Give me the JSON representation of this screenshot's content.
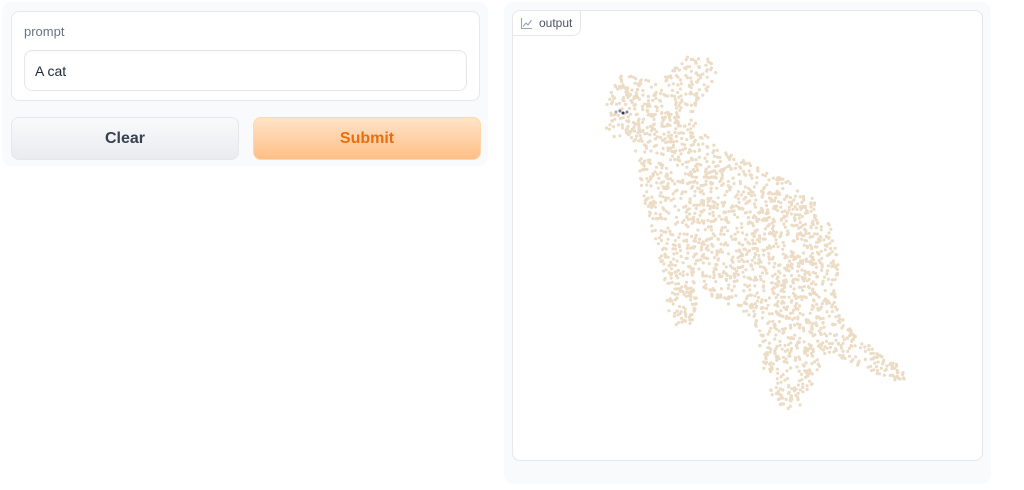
{
  "input": {
    "label": "prompt",
    "value": "A cat"
  },
  "buttons": {
    "clear_label": "Clear",
    "submit_label": "Submit"
  },
  "output": {
    "label": "output",
    "icon": "line-chart-icon",
    "point_color": "#ecdcc5",
    "eye_color": "#7f82a0"
  },
  "colors": {
    "accent": "#ea6e0c",
    "panel_bg": "#f8fafc",
    "border": "#e5e7eb"
  }
}
